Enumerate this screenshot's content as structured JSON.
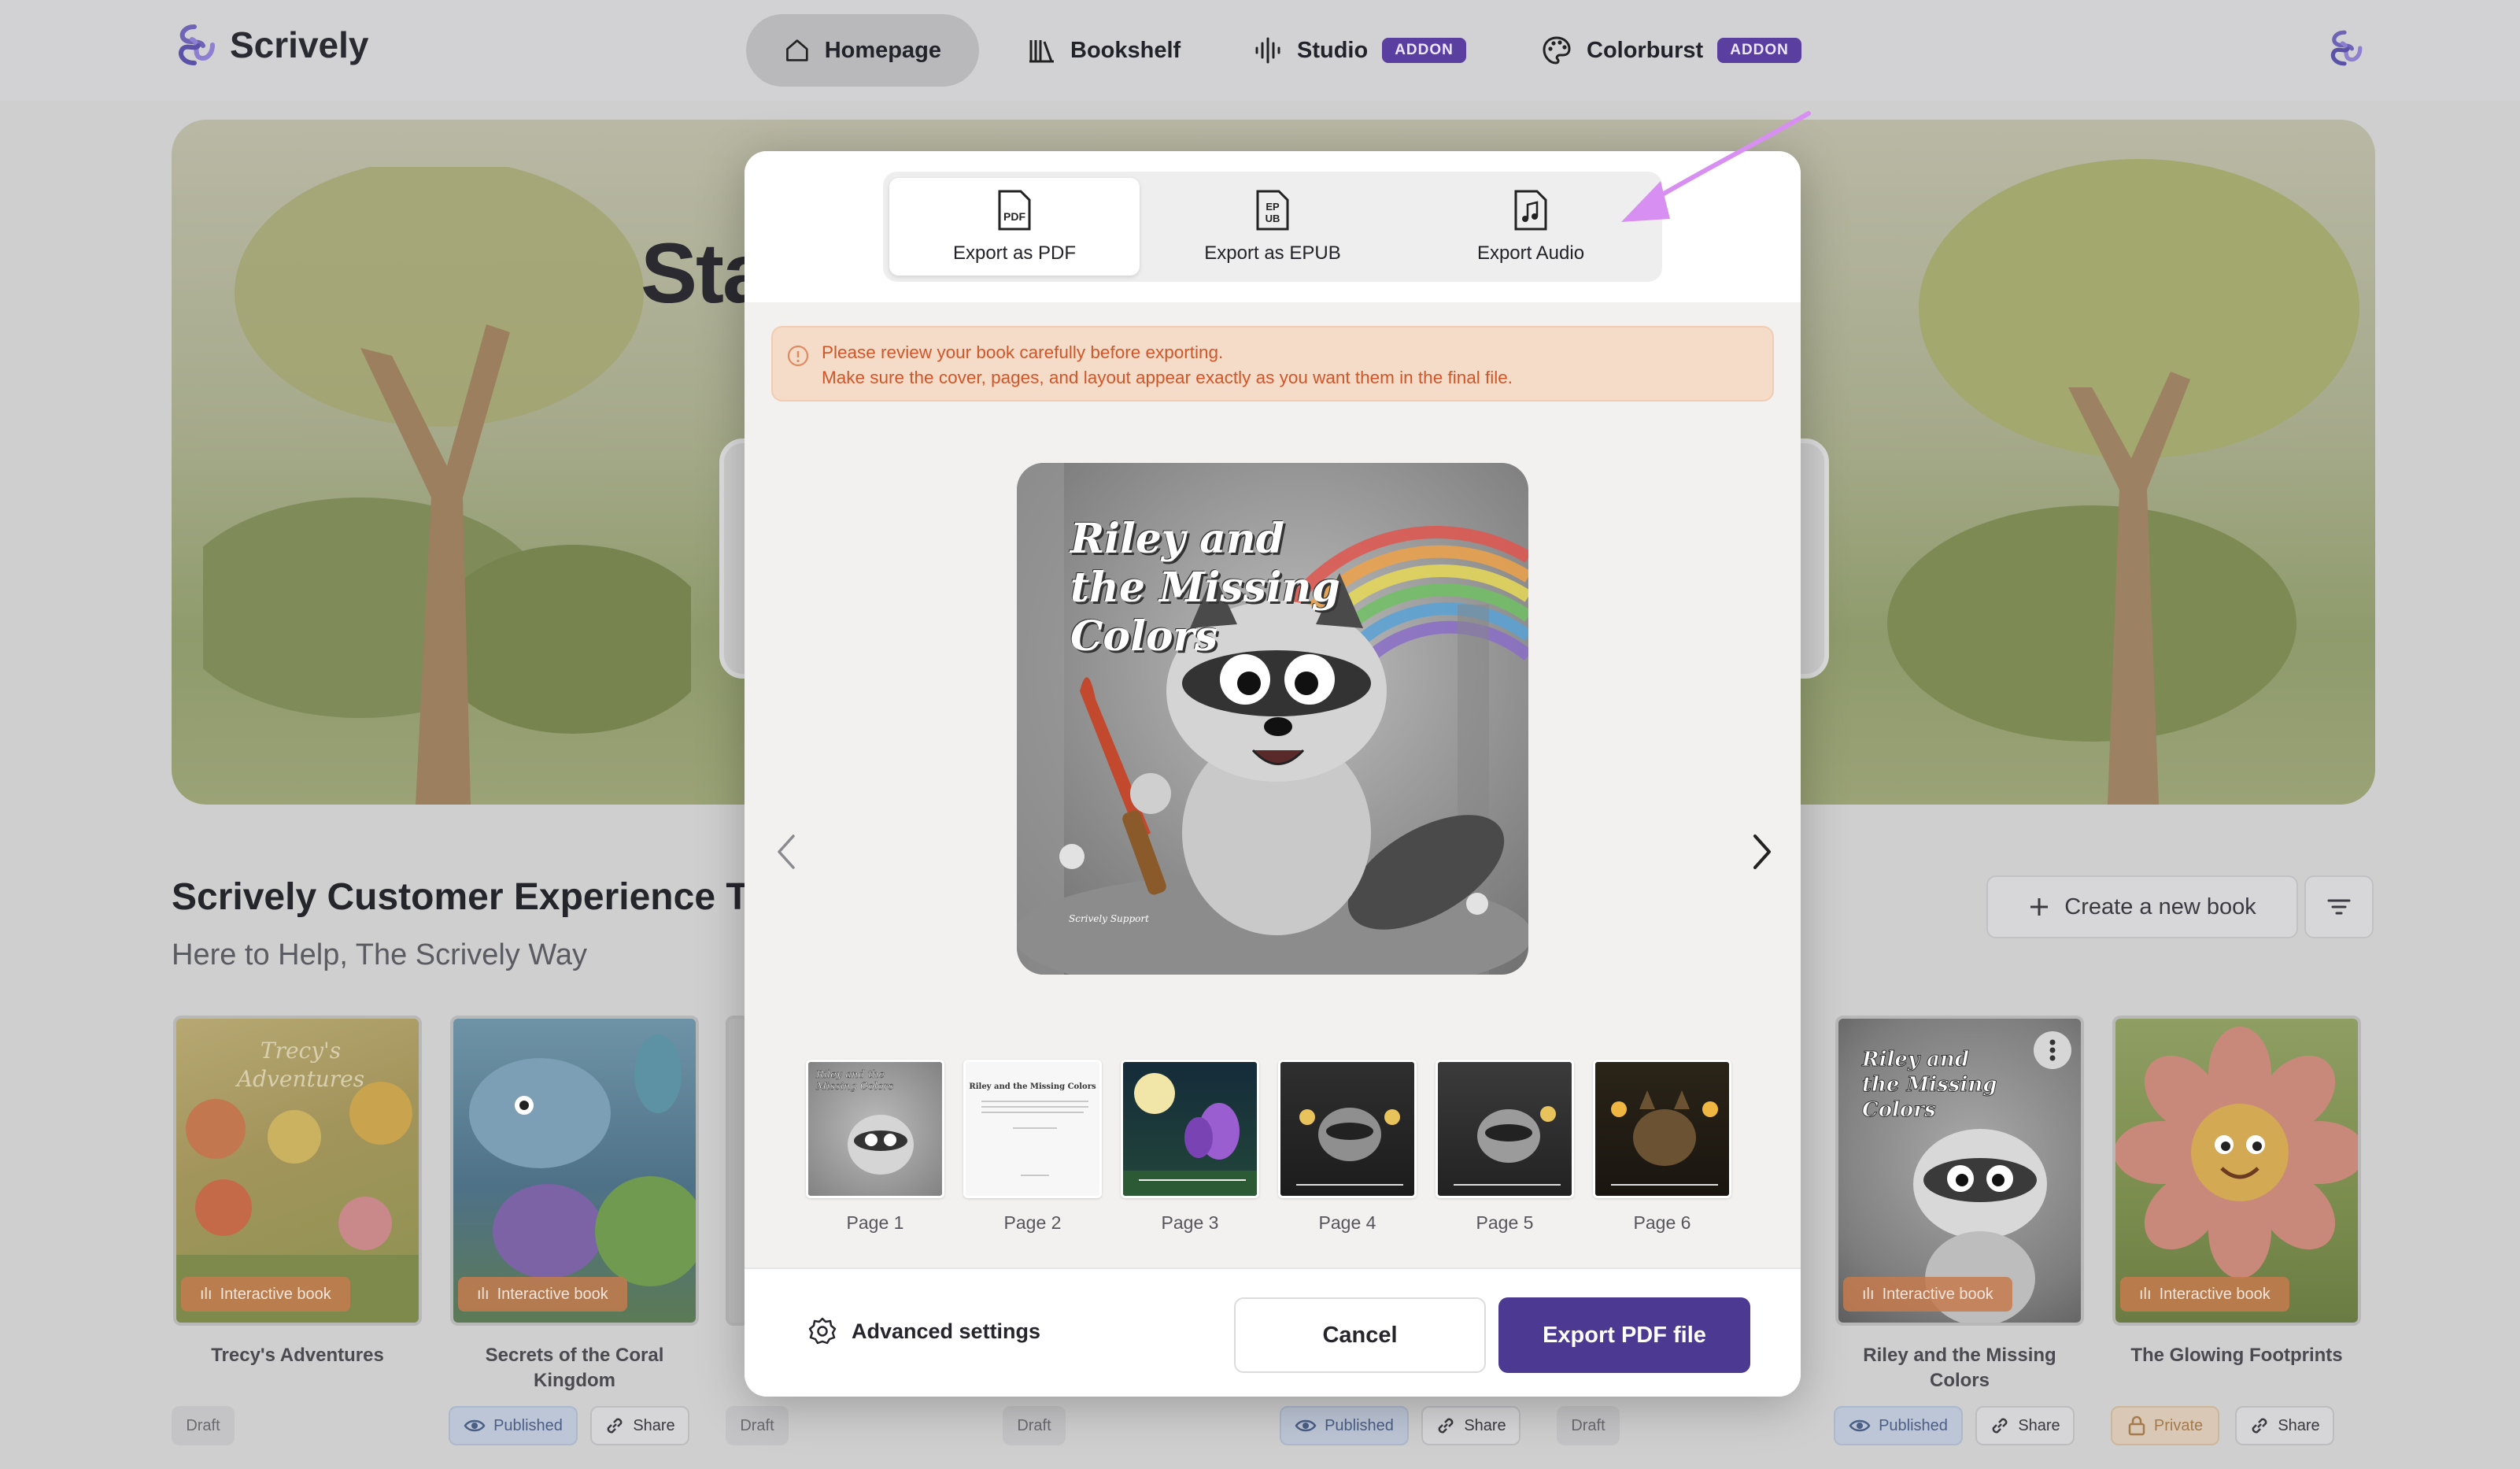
{
  "app": {
    "name": "Scrively",
    "colors": {
      "accent": "#4c3a92",
      "addon": "#5a3fa0",
      "warning_text": "#d0562a",
      "warning_bg": "#f5dcc8",
      "annotation": "#d88ff2"
    }
  },
  "nav": {
    "items": [
      {
        "label": "Homepage",
        "icon": "home-icon",
        "active": true
      },
      {
        "label": "Bookshelf",
        "icon": "bookshelf-icon"
      },
      {
        "label": "Studio",
        "icon": "audio-wave-icon",
        "badge": "ADDON"
      },
      {
        "label": "Colorburst",
        "icon": "palette-icon",
        "badge": "ADDON"
      }
    ]
  },
  "hero": {
    "title": "Sta                                                              lea"
  },
  "workspace": {
    "title": "Scrively Customer Experience Te",
    "subtitle": "Here to Help, The Scrively Way",
    "create_label": "Create a new book",
    "books": [
      {
        "title": "Trecy's Adventures",
        "tag": "Interactive book"
      },
      {
        "title": "Secrets of the Coral Kingdom",
        "tag": "Interactive book"
      },
      {
        "title": "Riley and the Missing Colors",
        "tag": "Interactive book"
      },
      {
        "title": "The Glowing Footprints",
        "tag": "Interactive book"
      }
    ],
    "chips": {
      "draft": "Draft",
      "published": "Published",
      "share": "Share",
      "private": "Private"
    }
  },
  "modal": {
    "tabs": [
      {
        "label": "Export as PDF",
        "icon": "pdf-file-icon",
        "active": true
      },
      {
        "label": "Export as EPUB",
        "icon": "epub-file-icon"
      },
      {
        "label": "Export Audio",
        "icon": "audio-file-icon"
      }
    ],
    "alert": {
      "line1": "Please review your book carefully before exporting.",
      "line2": "Make sure the cover, pages, and layout appear exactly as you want them in the final file."
    },
    "cover": {
      "title": "Riley and\nthe Missing\nColors",
      "credit": "Scrively Support"
    },
    "pages": [
      {
        "label": "Page 1"
      },
      {
        "label": "Page 2",
        "text": "Riley and the Missing Colors"
      },
      {
        "label": "Page 3"
      },
      {
        "label": "Page 4"
      },
      {
        "label": "Page 5"
      },
      {
        "label": "Page 6"
      }
    ],
    "footer": {
      "advanced": "Advanced settings",
      "cancel": "Cancel",
      "export": "Export PDF file"
    }
  }
}
